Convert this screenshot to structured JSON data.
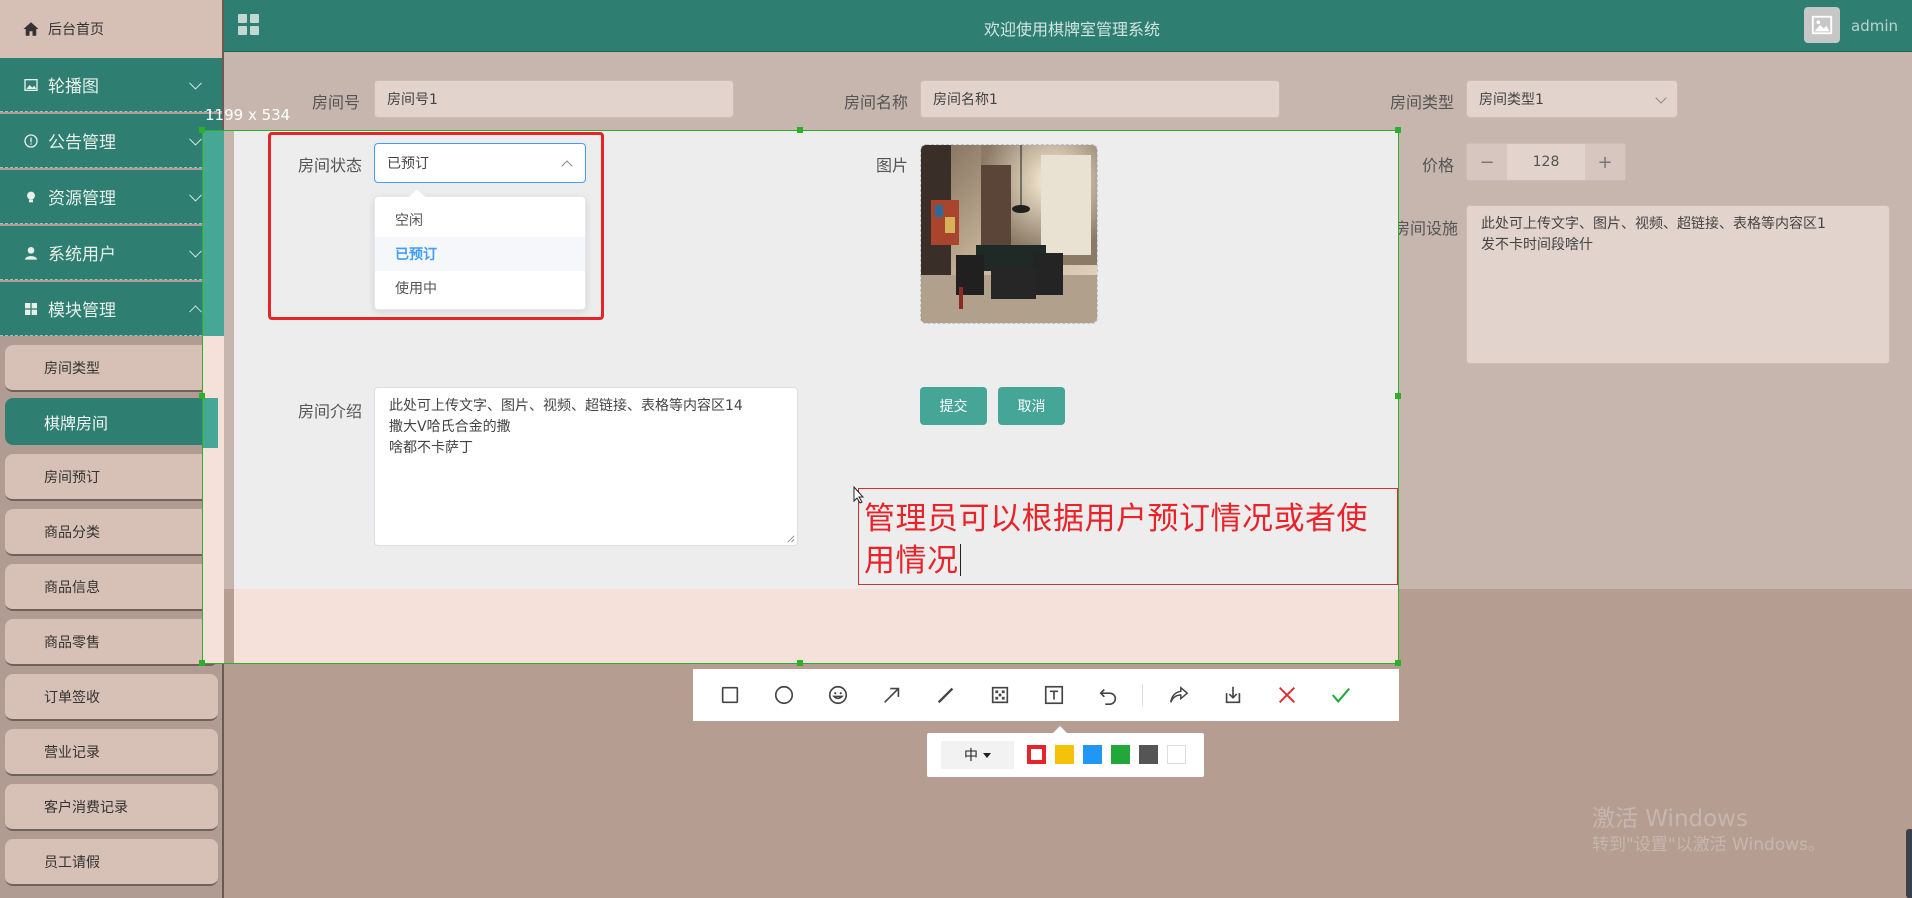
{
  "sidebar": {
    "home": "后台首页",
    "groups": [
      {
        "label": "轮播图",
        "icon": "image-icon",
        "expanded": false
      },
      {
        "label": "公告管理",
        "icon": "info-circle-icon",
        "expanded": false
      },
      {
        "label": "资源管理",
        "icon": "bulb-icon",
        "expanded": false
      },
      {
        "label": "系统用户",
        "icon": "user-icon",
        "expanded": false
      },
      {
        "label": "模块管理",
        "icon": "grid-icon",
        "expanded": true
      }
    ],
    "items": [
      {
        "label": "房间类型",
        "active": false
      },
      {
        "label": "棋牌房间",
        "active": true
      },
      {
        "label": "房间预订",
        "active": false
      },
      {
        "label": "商品分类",
        "active": false
      },
      {
        "label": "商品信息",
        "active": false
      },
      {
        "label": "商品零售",
        "active": false
      },
      {
        "label": "订单签收",
        "active": false
      },
      {
        "label": "营业记录",
        "active": false
      },
      {
        "label": "客户消费记录",
        "active": false
      },
      {
        "label": "员工请假",
        "active": false
      }
    ]
  },
  "header": {
    "title": "欢迎使用棋牌室管理系统",
    "username": "admin"
  },
  "form": {
    "room_no": {
      "label": "房间号",
      "value": "房间号1"
    },
    "room_name": {
      "label": "房间名称",
      "value": "房间名称1"
    },
    "room_type": {
      "label": "房间类型",
      "value": "房间类型1"
    },
    "room_status": {
      "label": "房间状态",
      "value": "已预订",
      "options": [
        "空闲",
        "已预订",
        "使用中"
      ]
    },
    "picture": {
      "label": "图片"
    },
    "price": {
      "label": "价格",
      "value": "128",
      "minus": "−",
      "plus": "+"
    },
    "facilities": {
      "label": "房间设施",
      "line1": "此处可上传文字、图片、视频、超链接、表格等内容区1",
      "line2": "发不卡时间段啥什"
    },
    "intro": {
      "label": "房间介绍",
      "line1": "此处可上传文字、图片、视频、超链接、表格等内容区14",
      "line2": "撒大V哈氏合金的撒",
      "line3": "啥都不卡萨丁"
    },
    "submit": "提交",
    "cancel": "取消"
  },
  "screenshot_tool": {
    "size_label": "1199 x 534",
    "annotation_text": "管理员可以根据用户预订情况或者使用情况",
    "font_size": "中",
    "colors": [
      "#e8242a",
      "#f5c20b",
      "#2196f3",
      "#22a83a",
      "#555555",
      "#ffffff"
    ],
    "selected_color": "#e8242a",
    "tools": [
      "rectangle-icon",
      "circle-icon",
      "emoji-icon",
      "arrow-icon",
      "pen-icon",
      "mosaic-icon",
      "text-icon",
      "undo-icon",
      "share-icon",
      "download-icon",
      "close-icon",
      "check-icon"
    ]
  },
  "os": {
    "watermark_line1": "激活 Windows",
    "watermark_line2": "转到\"设置\"以激活 Windows。"
  }
}
